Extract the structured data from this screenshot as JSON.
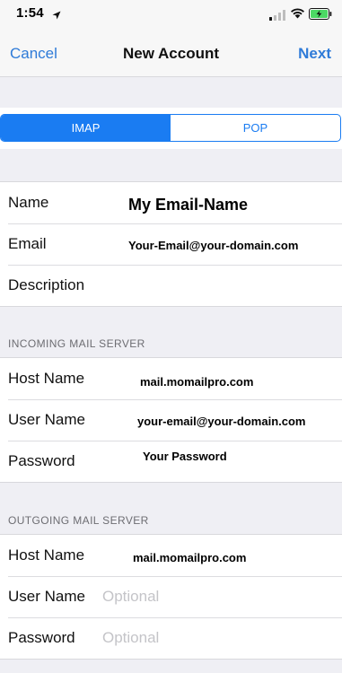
{
  "status_bar": {
    "time": "1:54"
  },
  "nav": {
    "cancel": "Cancel",
    "title": "New Account",
    "next": "Next"
  },
  "segments": {
    "imap": "IMAP",
    "pop": "POP",
    "selected": "IMAP"
  },
  "account": {
    "name_label": "Name",
    "name_value": "My Email-Name",
    "email_label": "Email",
    "email_value": "Your-Email@your-domain.com",
    "description_label": "Description"
  },
  "incoming": {
    "header": "INCOMING MAIL SERVER",
    "host_label": "Host Name",
    "host_value": "mail.momailpro.com",
    "user_label": "User Name",
    "user_value": "your-email@your-domain.com",
    "password_label": "Password",
    "password_value": "Your Password"
  },
  "outgoing": {
    "header": "OUTGOING MAIL SERVER",
    "host_label": "Host Name",
    "host_value": "mail.momailpro.com",
    "user_label": "User Name",
    "user_placeholder": "Optional",
    "password_label": "Password",
    "password_placeholder": "Optional"
  },
  "colors": {
    "accent": "#1a7cf2",
    "link": "#2f7bd8",
    "background": "#efeff4",
    "battery": "#4cd964"
  },
  "icons": {
    "location": "location-arrow-icon",
    "signal": "cellular-signal-icon",
    "wifi": "wifi-icon",
    "battery": "battery-charging-icon"
  }
}
